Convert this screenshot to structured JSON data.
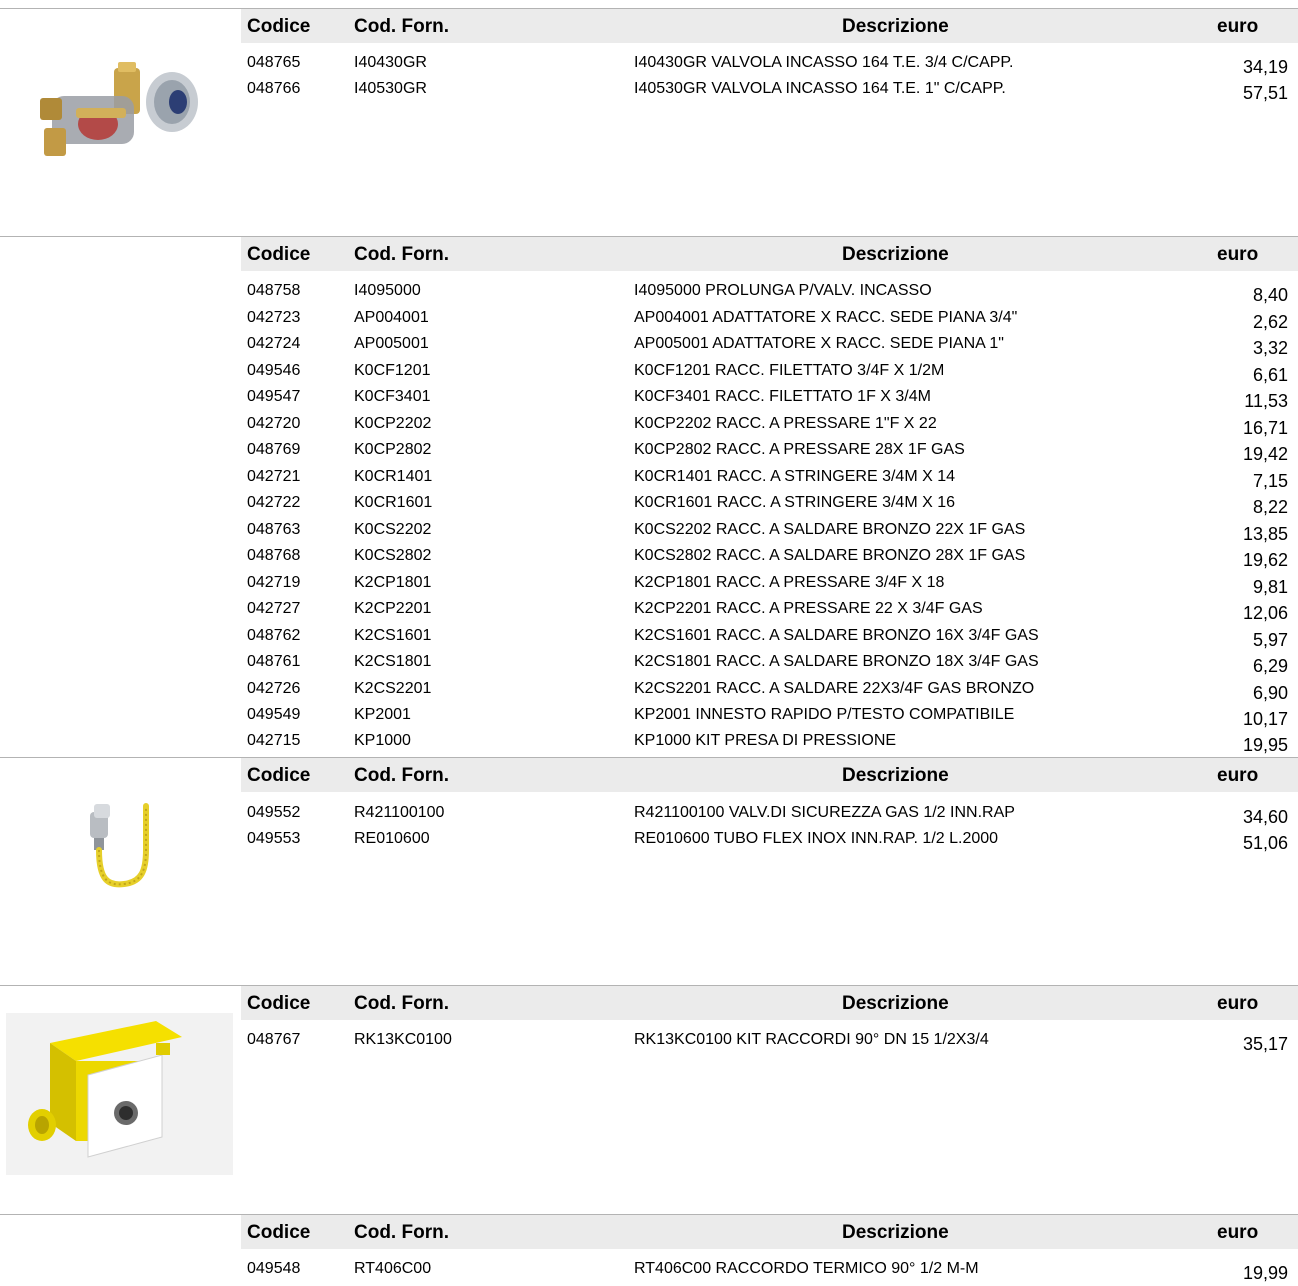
{
  "columns": {
    "code": "Codice",
    "supplier_code": "Cod. Forn.",
    "description": "Descrizione",
    "price": "euro"
  },
  "sections": [
    {
      "image": "recessed-valve-image",
      "rows": [
        {
          "code": "048765",
          "supplier_code": "I40430GR",
          "description": "I40430GR VALVOLA INCASSO 164 T.E. 3/4 C/CAPP.",
          "price": "34,19"
        },
        {
          "code": "048766",
          "supplier_code": "I40530GR",
          "description": "I40530GR VALVOLA INCASSO 164 T.E. 1\"  C/CAPP.",
          "price": "57,51"
        }
      ]
    },
    {
      "image": "",
      "rows": [
        {
          "code": "048758",
          "supplier_code": "I4095000",
          "description": "I4095000 PROLUNGA P/VALV. INCASSO",
          "price": "8,40"
        },
        {
          "code": "042723",
          "supplier_code": "AP004001",
          "description": "AP004001 ADATTATORE X RACC. SEDE PIANA 3/4\"",
          "price": "2,62"
        },
        {
          "code": "042724",
          "supplier_code": "AP005001",
          "description": "AP005001 ADATTATORE X RACC. SEDE PIANA   1\"",
          "price": "3,32"
        },
        {
          "code": "049546",
          "supplier_code": "K0CF1201",
          "description": "K0CF1201 RACC. FILETTATO 3/4F X 1/2M",
          "price": "6,61"
        },
        {
          "code": "049547",
          "supplier_code": "K0CF3401",
          "description": "K0CF3401 RACC. FILETTATO   1F X 3/4M",
          "price": "11,53"
        },
        {
          "code": "042720",
          "supplier_code": "K0CP2202",
          "description": "K0CP2202 RACC. A PRESSARE  1\"F X 22",
          "price": "16,71"
        },
        {
          "code": "048769",
          "supplier_code": "K0CP2802",
          "description": "K0CP2802 RACC. A PRESSARE        28X 1F GAS",
          "price": "19,42"
        },
        {
          "code": "042721",
          "supplier_code": "K0CR1401",
          "description": "K0CR1401 RACC. A STRINGERE 3/4M X 14",
          "price": "7,15"
        },
        {
          "code": "042722",
          "supplier_code": "K0CR1601",
          "description": "K0CR1601 RACC. A STRINGERE 3/4M X 16",
          "price": "8,22"
        },
        {
          "code": "048763",
          "supplier_code": "K0CS2202",
          "description": "K0CS2202 RACC. A SALDARE BRONZO 22X 1F   GAS",
          "price": "13,85"
        },
        {
          "code": "048768",
          "supplier_code": "K0CS2802",
          "description": "K0CS2802 RACC. A SALDARE BRONZO 28X 1F GAS",
          "price": "19,62"
        },
        {
          "code": "042719",
          "supplier_code": "K2CP1801",
          "description": "K2CP1801 RACC. A PRESSARE 3/4F X 18",
          "price": "9,81"
        },
        {
          "code": "042727",
          "supplier_code": "K2CP2201",
          "description": "K2CP2201 RACC. A PRESSARE 22 X 3/4F GAS",
          "price": "12,06"
        },
        {
          "code": "048762",
          "supplier_code": "K2CS1601",
          "description": "K2CS1601 RACC. A SALDARE BRONZO 16X 3/4F GAS",
          "price": "5,97"
        },
        {
          "code": "048761",
          "supplier_code": "K2CS1801",
          "description": "K2CS1801 RACC. A SALDARE BRONZO 18X 3/4F GAS",
          "price": "6,29"
        },
        {
          "code": "042726",
          "supplier_code": "K2CS2201",
          "description": "K2CS2201 RACC. A SALDARE 22X3/4F GAS BRONZO",
          "price": "6,90"
        },
        {
          "code": "049549",
          "supplier_code": "KP2001",
          "description": "KP2001 INNESTO RAPIDO P/TESTO COMPATIBILE",
          "price": "10,17"
        },
        {
          "code": "042715",
          "supplier_code": "KP1000",
          "description": "KP1000 KIT PRESA DI PRESSIONE",
          "price": "19,95"
        }
      ]
    },
    {
      "image": "flex-hose-image",
      "rows": [
        {
          "code": "049552",
          "supplier_code": "R421100100",
          "description": "R421100100 VALV.DI SICUREZZA GAS 1/2 INN.RAP",
          "price": "34,60"
        },
        {
          "code": "049553",
          "supplier_code": "RE010600",
          "description": "RE010600 TUBO FLEX INOX INN.RAP. 1/2 L.2000",
          "price": "51,06"
        }
      ]
    },
    {
      "image": "fitting-kit-box-image",
      "rows": [
        {
          "code": "048767",
          "supplier_code": "RK13KC0100",
          "description": "RK13KC0100 KIT RACCORDI 90° DN 15 1/2X3/4",
          "price": "35,17"
        }
      ]
    },
    {
      "image": "",
      "rows": [
        {
          "code": "049548",
          "supplier_code": "RT406C00",
          "description": "RT406C00 RACCORDO TERMICO 90° 1/2 M-M",
          "price": "19,99"
        }
      ]
    }
  ]
}
